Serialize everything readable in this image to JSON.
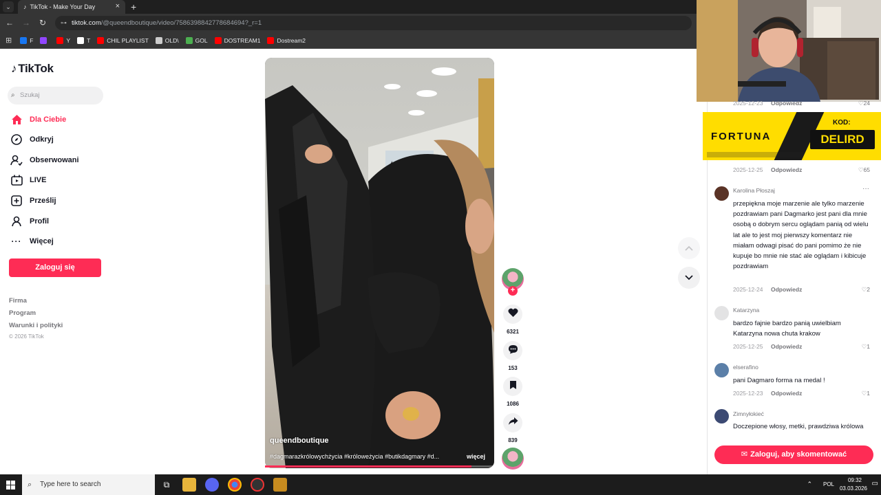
{
  "browser": {
    "tab_title": "TikTok - Make Your Day",
    "url_host": "tiktok.com",
    "url_path": "/@queendboutique/video/7586398842778684694?_r=1",
    "bookmarks": [
      {
        "label": "F",
        "color": "#1877f2"
      },
      {
        "label": "",
        "color": "#9146ff"
      },
      {
        "label": "Y",
        "color": "#ff0000"
      },
      {
        "label": "T",
        "color": "#ffffff"
      },
      {
        "label": "CHIL PLAYLIST",
        "color": "#ff0000"
      },
      {
        "label": "OLD\\",
        "color": "#cccccc"
      },
      {
        "label": "GOL",
        "color": "#4caf50"
      },
      {
        "label": "DOSTREAM1",
        "color": "#ff0000"
      },
      {
        "label": "Dostream2",
        "color": "#ff0000"
      }
    ]
  },
  "sidebar": {
    "logo": "TikTok",
    "search_placeholder": "Szukaj",
    "items": [
      {
        "label": "Dla Ciebie",
        "icon": "home-icon"
      },
      {
        "label": "Odkryj",
        "icon": "compass-icon"
      },
      {
        "label": "Obserwowani",
        "icon": "following-icon"
      },
      {
        "label": "LIVE",
        "icon": "live-icon"
      },
      {
        "label": "Prześlij",
        "icon": "upload-icon"
      },
      {
        "label": "Profil",
        "icon": "profile-icon"
      },
      {
        "label": "Więcej",
        "icon": "more-icon"
      }
    ],
    "login_label": "Zaloguj się",
    "footer": [
      "Firma",
      "Program",
      "Warunki i polityki"
    ],
    "copyright": "© 2026 TikTok"
  },
  "video": {
    "author": "queendboutique",
    "tags": "#dagmarazkrólowychżycia #króloweżycia #butikdagmary #d...",
    "more": "więcej",
    "progress": 0.9
  },
  "actions": {
    "likes": "6321",
    "comments": "153",
    "saves": "1086",
    "shares": "839"
  },
  "ad": {
    "brand": "FORTUNA",
    "code_label": "KOD:",
    "code": "DELIRD"
  },
  "comments": {
    "partial_top": {
      "date": "2025-12-23",
      "reply": "Odpowiedz",
      "likes": "24"
    },
    "partial_second": {
      "date": "2025-12-25",
      "reply": "Odpowiedz",
      "likes": "65"
    },
    "list": [
      {
        "name": "Karolina Płoszaj",
        "text": "przepiękna moje marzenie ale tylko marzenie pozdrawiam pani Dagmarko jest pani dla mnie osobą o dobrym sercu oglądam panią od wielu lat ale to jest moj pierwszy komentarz nie miałam odwagi pisać do pani pomimo że nie kupuje bo mnie nie stać ale oglądam i kibicuje pozdrawiam",
        "date": "2025-12-24",
        "reply": "Odpowiedz",
        "likes": "2"
      },
      {
        "name": "Katarzyna",
        "text": "bardzo fajnie bardzo panią uwielbiam Katarzyna nowa chuta krakow",
        "date": "2025-12-25",
        "reply": "Odpowiedz",
        "likes": "1"
      },
      {
        "name": "elserafino",
        "text": "pani Dagmaro forma na medal !",
        "date": "2025-12-23",
        "reply": "Odpowiedz",
        "likes": "1"
      },
      {
        "name": "Zimnyłokieć",
        "text": "Doczepione włosy, metki, prawdziwa królowa",
        "date": "",
        "reply": "",
        "likes": ""
      }
    ],
    "login_to_comment": "Zaloguj, aby skomentować"
  },
  "taskbar": {
    "search_placeholder": "Type here to search",
    "lang": "POL",
    "time": "09:32",
    "date": "03.03.2026"
  }
}
